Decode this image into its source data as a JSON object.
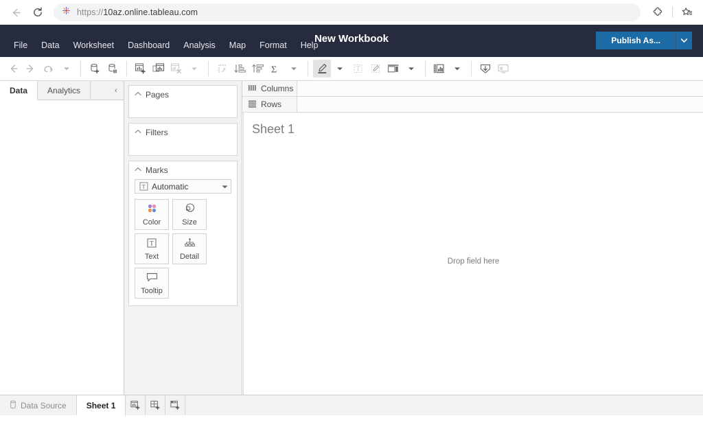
{
  "browser": {
    "back_title": "Back",
    "forward_title": "Forward",
    "reload_title": "Reload",
    "url": "https://10az.online.tableau.com",
    "url_scheme": "https://",
    "url_host": "10az.online.tableau.com",
    "extensions_title": "Extensions",
    "favorites_title": "Favorites"
  },
  "header": {
    "title": "New Workbook",
    "publish_label": "Publish As...",
    "publish_caret_label": "▼",
    "accent_blue": "#1d6ba4",
    "bar_color": "#262b3e",
    "menus": [
      {
        "label": "File"
      },
      {
        "label": "Data"
      },
      {
        "label": "Worksheet"
      },
      {
        "label": "Dashboard"
      },
      {
        "label": "Analysis"
      },
      {
        "label": "Map"
      },
      {
        "label": "Format"
      },
      {
        "label": "Help"
      }
    ]
  },
  "toolbar": {
    "items": [
      {
        "name": "undo-icon",
        "title": "Undo"
      },
      {
        "name": "redo-icon",
        "title": "Redo"
      },
      {
        "name": "revert-icon",
        "title": "Revert"
      },
      {
        "name": "revert-caret-icon",
        "title": "Revert options"
      },
      {
        "name": "new-data-source-icon",
        "title": "New Data Source"
      },
      {
        "name": "pause-data-updates-icon",
        "title": "Pause Automatic Updates"
      },
      {
        "name": "new-worksheet-icon",
        "title": "New Worksheet"
      },
      {
        "name": "duplicate-sheet-icon",
        "title": "Duplicate Sheet"
      },
      {
        "name": "clear-sheet-icon",
        "title": "Clear Sheet"
      },
      {
        "name": "swap-axes-icon",
        "title": "Swap Rows and Columns"
      },
      {
        "name": "sort-ascending-icon",
        "title": "Sort Ascending"
      },
      {
        "name": "sort-descending-icon",
        "title": "Sort Descending"
      },
      {
        "name": "totals-icon",
        "title": "Totals"
      },
      {
        "name": "highlight-icon",
        "title": "Highlight",
        "active": true
      },
      {
        "name": "text-box-icon",
        "title": "Text Box",
        "disabled": true
      },
      {
        "name": "annotation-icon",
        "title": "Annotate",
        "disabled": true
      },
      {
        "name": "containers-icon",
        "title": "Fit / Containers"
      },
      {
        "name": "show-me-icon",
        "title": "Show Me"
      },
      {
        "name": "download-icon",
        "title": "Download"
      },
      {
        "name": "presentation-mode-icon",
        "title": "Presentation Mode",
        "disabled": true
      }
    ]
  },
  "data_pane": {
    "tabs": [
      {
        "label": "Data",
        "active": true
      },
      {
        "label": "Analytics",
        "active": false
      }
    ],
    "collapse_glyph": "‹"
  },
  "cards": {
    "pages": {
      "title": "Pages",
      "chevron": "⌃"
    },
    "filters": {
      "title": "Filters",
      "chevron": "⌃"
    },
    "marks": {
      "title": "Marks",
      "chevron": "⌃",
      "mark_type": "Automatic",
      "mark_type_caret": "▼",
      "buttons": [
        {
          "label": "Color",
          "icon": "color-icon"
        },
        {
          "label": "Size",
          "icon": "size-icon"
        },
        {
          "label": "Text",
          "icon": "text-icon"
        },
        {
          "label": "Detail",
          "icon": "detail-icon"
        },
        {
          "label": "Tooltip",
          "icon": "tooltip-icon"
        }
      ]
    }
  },
  "worksheet": {
    "columns_label": "Columns",
    "rows_label": "Rows",
    "sheet_title": "Sheet 1",
    "drop_hint": "Drop field here"
  },
  "statusbar": {
    "data_source_label": "Data Source",
    "sheet_tab_label": "Sheet 1",
    "new_worksheet_title": "New Worksheet",
    "new_dashboard_title": "New Dashboard",
    "new_story_title": "New Story"
  }
}
